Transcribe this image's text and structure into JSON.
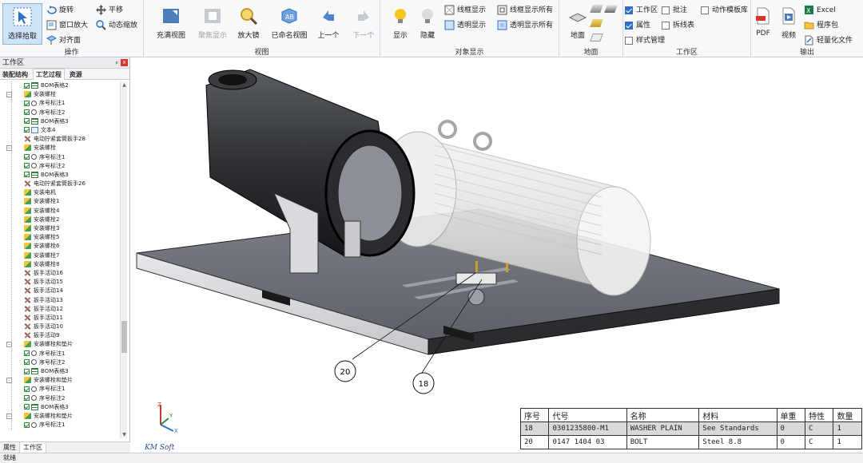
{
  "ribbon": {
    "ops": {
      "label": "操作",
      "select": "选择拾取",
      "rotate": "旋转",
      "pan": "平移",
      "window_zoom": "窗口放大",
      "dynamic_zoom": "动态缩放",
      "face_align": "对齐面"
    },
    "view": {
      "label": "视图",
      "fill_view": "充满视图",
      "focus_show": "聚焦显示",
      "magnifier": "放大镜",
      "named_view": "已命名视图",
      "prev": "上一个",
      "next": "下一个"
    },
    "objshow": {
      "label": "对象显示",
      "show": "显示",
      "hide": "隐藏",
      "wire_show": "线框显示",
      "transparent_show": "透明显示",
      "wire_show_all": "线框显示所有",
      "transparent_show_all": "透明显示所有"
    },
    "ground": {
      "label": "地面",
      "ground": "地面"
    },
    "workspace": {
      "label": "工作区",
      "workspace": "工作区",
      "annotate": "批注",
      "anim_template": "动作模板库",
      "property": "属性",
      "exploded_table": "拆线表",
      "style_mgmt": "样式管理"
    },
    "output": {
      "label": "输出",
      "pdf": "PDF",
      "video": "视频",
      "excel": "Excel",
      "package": "程序包",
      "lightweight": "轻量化文件"
    }
  },
  "left_panel": {
    "title": "工作区",
    "pin": "ᵖ",
    "close": "x",
    "tabs": [
      "装配结构",
      "工艺过程",
      "资源"
    ],
    "bottom_tabs": [
      "属性",
      "工作区"
    ],
    "tree": [
      {
        "indent": 5,
        "icon": "tbl",
        "check": true,
        "label": "BOM表格2"
      },
      {
        "indent": 4,
        "icon": "asm",
        "exp": "-",
        "label": "安装螺栓"
      },
      {
        "indent": 5,
        "icon": "tag",
        "check": true,
        "label": "序号标注1"
      },
      {
        "indent": 5,
        "icon": "tag",
        "check": true,
        "label": "序号标注2"
      },
      {
        "indent": 5,
        "icon": "tbl",
        "check": true,
        "label": "BOM表格3"
      },
      {
        "indent": 5,
        "icon": "txt",
        "check": true,
        "label": "文本4"
      },
      {
        "indent": 4,
        "icon": "tool",
        "label": "电动拧紧套筒扳手28"
      },
      {
        "indent": 4,
        "icon": "asm",
        "exp": "-",
        "label": "安装螺栓"
      },
      {
        "indent": 5,
        "icon": "tag",
        "check": true,
        "label": "序号标注1"
      },
      {
        "indent": 5,
        "icon": "tag",
        "check": true,
        "label": "序号标注2"
      },
      {
        "indent": 5,
        "icon": "tbl",
        "check": true,
        "label": "BOM表格3"
      },
      {
        "indent": 4,
        "icon": "tool",
        "label": "电动拧紧套筒扳手26"
      },
      {
        "indent": 4,
        "icon": "asm",
        "label": "安装电机"
      },
      {
        "indent": 4,
        "icon": "asm",
        "label": "安装螺栓1"
      },
      {
        "indent": 4,
        "icon": "asm",
        "label": "安装螺栓4"
      },
      {
        "indent": 4,
        "icon": "asm",
        "label": "安装螺栓2"
      },
      {
        "indent": 4,
        "icon": "asm",
        "label": "安装螺栓3"
      },
      {
        "indent": 4,
        "icon": "asm",
        "label": "安装螺栓5"
      },
      {
        "indent": 4,
        "icon": "asm",
        "label": "安装螺栓6"
      },
      {
        "indent": 4,
        "icon": "asm",
        "label": "安装螺栓7"
      },
      {
        "indent": 4,
        "icon": "asm",
        "label": "安装螺栓8"
      },
      {
        "indent": 4,
        "icon": "tool",
        "label": "扳手活动16"
      },
      {
        "indent": 4,
        "icon": "tool",
        "label": "扳手活动15"
      },
      {
        "indent": 4,
        "icon": "tool",
        "label": "扳手活动14"
      },
      {
        "indent": 4,
        "icon": "tool",
        "label": "扳手活动13"
      },
      {
        "indent": 4,
        "icon": "tool",
        "label": "扳手活动12"
      },
      {
        "indent": 4,
        "icon": "tool",
        "label": "扳手活动11"
      },
      {
        "indent": 4,
        "icon": "tool",
        "label": "扳手活动10"
      },
      {
        "indent": 4,
        "icon": "tool",
        "label": "扳手活动9"
      },
      {
        "indent": 4,
        "icon": "asm",
        "exp": "-",
        "label": "安装螺栓和垫片"
      },
      {
        "indent": 5,
        "icon": "tag",
        "check": true,
        "label": "序号标注1"
      },
      {
        "indent": 5,
        "icon": "tag",
        "check": true,
        "label": "序号标注2"
      },
      {
        "indent": 5,
        "icon": "tbl",
        "check": true,
        "label": "BOM表格3"
      },
      {
        "indent": 4,
        "icon": "asm",
        "exp": "-",
        "label": "安装螺栓和垫片"
      },
      {
        "indent": 5,
        "icon": "tag",
        "check": true,
        "label": "序号标注1"
      },
      {
        "indent": 5,
        "icon": "tag",
        "check": true,
        "label": "序号标注2"
      },
      {
        "indent": 5,
        "icon": "tbl",
        "check": true,
        "label": "BOM表格3"
      },
      {
        "indent": 4,
        "icon": "asm",
        "exp": "-",
        "label": "安装螺栓和垫片"
      },
      {
        "indent": 5,
        "icon": "tag",
        "check": true,
        "label": "序号标注1"
      }
    ]
  },
  "viewport": {
    "callouts": [
      "20",
      "18"
    ],
    "logo_text": "KM Soft",
    "axis_labels": [
      "Z",
      "X",
      "Y"
    ]
  },
  "bom": {
    "headers": [
      "序号",
      "代号",
      "名称",
      "材料",
      "单重",
      "特性",
      "数量"
    ],
    "rows": [
      [
        "18",
        "0301235800-M1",
        "WASHER PLAIN",
        "See Standards",
        "0",
        "C",
        "1"
      ],
      [
        "20",
        "0147 1404 03",
        "BOLT",
        "Steel 8.8",
        "0",
        "C",
        "1"
      ]
    ],
    "highlight_color": "#d9d9d9"
  },
  "status": {
    "text": "就绪"
  },
  "colors": {
    "accent": "#2d6fc4",
    "selected_button": "#cfe3f6",
    "close": "#d9362b"
  }
}
